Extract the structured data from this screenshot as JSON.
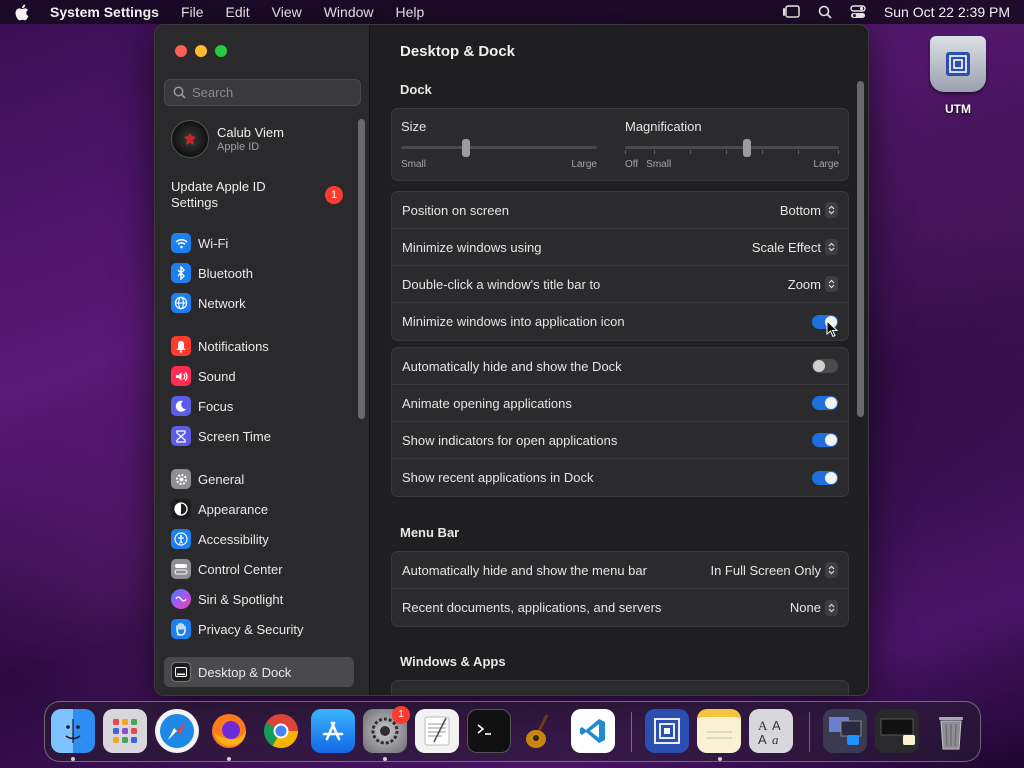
{
  "menubar": {
    "app_name": "System Settings",
    "items": [
      "File",
      "Edit",
      "View",
      "Window",
      "Help"
    ],
    "clock": "Sun Oct 22  2:39 PM"
  },
  "desktop": {
    "utm_label": "UTM"
  },
  "sidebar": {
    "search_placeholder": "Search",
    "account": {
      "name": "Calub Viem",
      "subtitle": "Apple ID"
    },
    "update": {
      "label": "Update Apple ID Settings",
      "badge": "1"
    },
    "groups": [
      [
        {
          "label": "Wi-Fi",
          "icon": "wifi-icon",
          "color": "#1e80f0"
        },
        {
          "label": "Bluetooth",
          "icon": "bluetooth-icon",
          "color": "#1e80f0"
        },
        {
          "label": "Network",
          "icon": "globe-icon",
          "color": "#1e80f0"
        }
      ],
      [
        {
          "label": "Notifications",
          "icon": "bell-icon",
          "color": "#ff3b30"
        },
        {
          "label": "Sound",
          "icon": "speaker-icon",
          "color": "#ff2d55"
        },
        {
          "label": "Focus",
          "icon": "moon-icon",
          "color": "#5e5ce6"
        },
        {
          "label": "Screen Time",
          "icon": "hourglass-icon",
          "color": "#5e5ce6"
        }
      ],
      [
        {
          "label": "General",
          "icon": "gear-icon",
          "color": "#8e8e93"
        },
        {
          "label": "Appearance",
          "icon": "appearance-icon",
          "color": "#1c1c1e"
        },
        {
          "label": "Accessibility",
          "icon": "accessibility-icon",
          "color": "#1e80f0"
        },
        {
          "label": "Control Center",
          "icon": "control-center-icon",
          "color": "#8e8e93"
        },
        {
          "label": "Siri & Spotlight",
          "icon": "siri-icon",
          "color": "#7a3ce0"
        },
        {
          "label": "Privacy & Security",
          "icon": "hand-icon",
          "color": "#1e80f0"
        }
      ],
      [
        {
          "label": "Desktop & Dock",
          "icon": "dock-icon",
          "color": "#1c1c1e",
          "active": true
        }
      ]
    ]
  },
  "main": {
    "title": "Desktop & Dock",
    "dock_heading": "Dock",
    "size": {
      "label": "Size",
      "min": "Small",
      "max": "Large",
      "value": 0.33
    },
    "magnification": {
      "label": "Magnification",
      "off": "Off",
      "min": "Small",
      "max": "Large",
      "value": 0.57
    },
    "dock_rows": [
      {
        "label": "Position on screen",
        "value": "Bottom"
      },
      {
        "label": "Minimize windows using",
        "value": "Scale Effect"
      },
      {
        "label": "Double-click a window's title bar to",
        "value": "Zoom"
      },
      {
        "label": "Minimize windows into application icon",
        "toggle": true
      }
    ],
    "dock_toggles": [
      {
        "label": "Automatically hide and show the Dock",
        "toggle": false
      },
      {
        "label": "Animate opening applications",
        "toggle": true
      },
      {
        "label": "Show indicators for open applications",
        "toggle": true
      },
      {
        "label": "Show recent applications in Dock",
        "toggle": true
      }
    ],
    "menubar_heading": "Menu Bar",
    "menubar_rows": [
      {
        "label": "Automatically hide and show the menu bar",
        "value": "In Full Screen Only"
      },
      {
        "label": "Recent documents, applications, and servers",
        "value": "None"
      }
    ],
    "windows_heading": "Windows & Apps"
  },
  "dock": {
    "apps": [
      {
        "name": "finder",
        "icon": "finder-icon",
        "color": "#2e8df0",
        "running": true
      },
      {
        "name": "launchpad",
        "icon": "launchpad-icon",
        "color": "#d8d8dc",
        "running": false
      },
      {
        "name": "safari",
        "icon": "safari-icon",
        "color": "#1e88e5",
        "running": false
      },
      {
        "name": "firefox",
        "icon": "firefox-icon",
        "color": "#ff7a1a",
        "running": true
      },
      {
        "name": "chrome",
        "icon": "chrome-icon",
        "color": "#ffffff",
        "running": false
      },
      {
        "name": "app-store",
        "icon": "app-store-icon",
        "color": "#1e90ff",
        "running": false
      },
      {
        "name": "system-settings",
        "icon": "gear-icon",
        "color": "#8e8e93",
        "running": true,
        "badge": "1"
      },
      {
        "name": "textedit",
        "icon": "textedit-icon",
        "color": "#f0f0f0",
        "running": false
      },
      {
        "name": "terminal",
        "icon": "terminal-icon",
        "color": "#111111",
        "running": false
      },
      {
        "name": "garageband",
        "icon": "guitar-icon",
        "color": "#c8860d",
        "running": false
      },
      {
        "name": "vscode",
        "icon": "vscode-icon",
        "color": "#ffffff",
        "running": false
      },
      {
        "name": "utm",
        "icon": "utm-icon",
        "color": "#2a4fb0",
        "running": false
      },
      {
        "name": "notes",
        "icon": "notes-icon",
        "color": "#f9f3d4",
        "running": true
      },
      {
        "name": "font-book",
        "icon": "font-book-icon",
        "color": "#d8d8dc",
        "running": false
      },
      {
        "name": "downloads-stack",
        "icon": "stack-icon",
        "color": "#3a3a50",
        "running": false
      },
      {
        "name": "recent-stack",
        "icon": "stack-icon",
        "color": "#2a2a2c",
        "running": false
      },
      {
        "name": "trash",
        "icon": "trash-icon",
        "color": "#8e8e93",
        "running": false
      }
    ]
  }
}
